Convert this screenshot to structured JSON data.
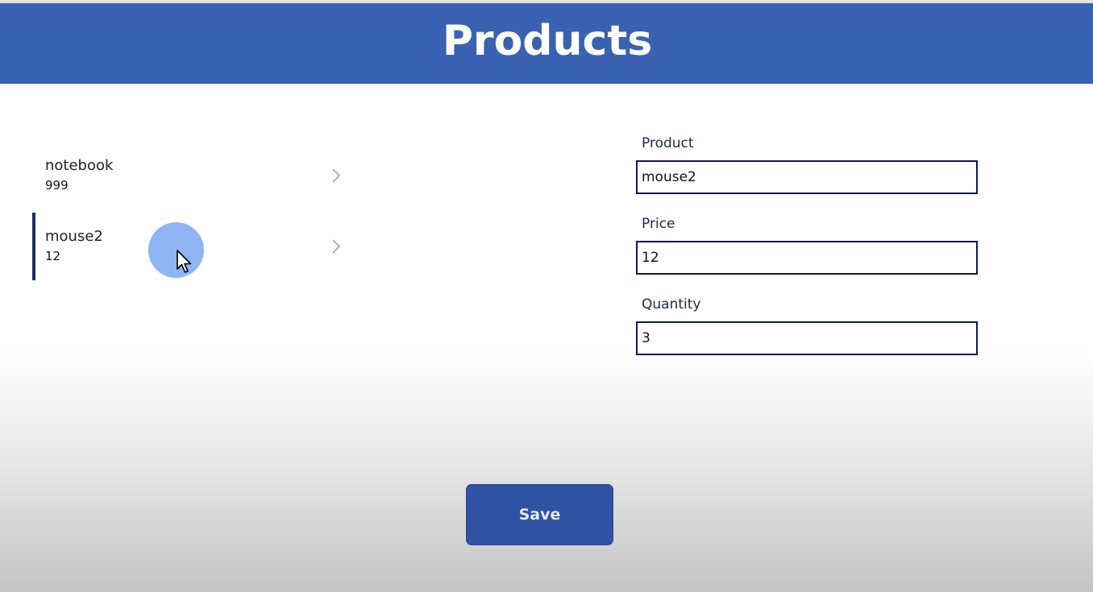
{
  "header": {
    "title": "Products"
  },
  "gallery": {
    "items": [
      {
        "title": "notebook",
        "subtitle": "999",
        "selected": false,
        "icon": "chevron-right-icon"
      },
      {
        "title": "mouse2",
        "subtitle": "12",
        "selected": true,
        "icon": "chevron-right-icon"
      }
    ]
  },
  "form": {
    "product": {
      "label": "Product",
      "value": "mouse2"
    },
    "price": {
      "label": "Price",
      "value": "12"
    },
    "quantity": {
      "label": "Quantity",
      "value": "3"
    }
  },
  "actions": {
    "save_label": "Save"
  },
  "colors": {
    "header": "#3a62b3",
    "selection_bar": "#1f2a64",
    "input_border": "#0f1a4c",
    "button": "#2f53a2",
    "touch_indicator": "#8eb4f4"
  }
}
